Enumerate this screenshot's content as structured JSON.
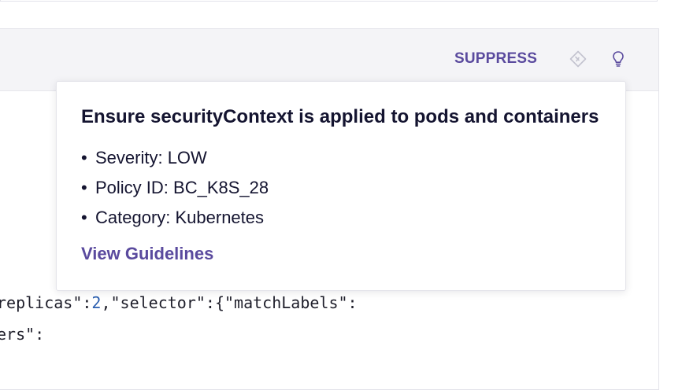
{
  "header": {
    "suppress_label": "SUPPRESS",
    "icons": [
      "fix-icon",
      "lightbulb-icon"
    ]
  },
  "code": {
    "line1": {
      "before": "replicas\":",
      "number": "2",
      "after": ",\"selector\":{\"matchLabels\":"
    },
    "line2": "ers\":"
  },
  "popover": {
    "title": "Ensure securityContext is applied to pods and containers",
    "bullet": "•",
    "items": [
      {
        "label": "Severity: LOW"
      },
      {
        "label": "Policy ID: BC_K8S_28"
      },
      {
        "label": "Category: Kubernetes"
      }
    ],
    "link_label": "View Guidelines"
  },
  "colors": {
    "accent": "#5a4a9e",
    "header_bg": "#f4f4f7",
    "text": "#141430",
    "code_number": "#2c5fb0"
  }
}
